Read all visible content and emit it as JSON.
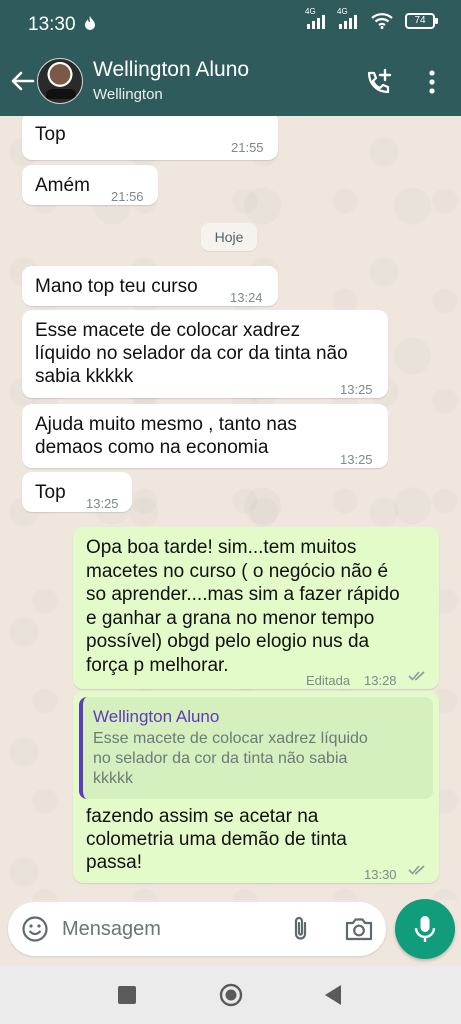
{
  "status_bar": {
    "time": "13:30",
    "network_1": "4G",
    "network_2": "4G",
    "battery": "74"
  },
  "header": {
    "contact_name": "Wellington Aluno",
    "contact_subtitle": "Wellington",
    "icons": [
      "back-arrow-icon",
      "add-call-icon",
      "more-vert-icon"
    ]
  },
  "chat": {
    "date_chip": "Hoje",
    "messages": [
      {
        "dir": "in",
        "text": "Top",
        "time": "21:55"
      },
      {
        "dir": "in",
        "text": "Amém",
        "time": "21:56"
      },
      {
        "dir": "in",
        "text": "Mano top teu curso",
        "time": "13:24"
      },
      {
        "dir": "in",
        "text": "Esse macete de colocar xadrez\nlíquido no selador da cor da tinta não\nsabia kkkkk",
        "time": "13:25"
      },
      {
        "dir": "in",
        "text": "Ajuda muito mesmo , tanto nas\ndemaos como na economia",
        "time": "13:25"
      },
      {
        "dir": "in",
        "text": "Top",
        "time": "13:25"
      },
      {
        "dir": "out",
        "text": "Opa boa tarde! sim...tem muitos\nmacetes no curso ( o negócio não é\nso aprender....mas sim a fazer rápido\ne ganhar a grana no menor tempo\npossível) obgd pelo elogio nus da\nforça p melhorar.",
        "edited_label": "Editada",
        "time": "13:28"
      },
      {
        "dir": "out",
        "quote_author": "Wellington Aluno",
        "quote_text": "Esse macete de colocar xadrez líquido\nno selador da cor da tinta não sabia\nkkkkk",
        "text": "fazendo assim se acetar na\ncolometria uma demão de tinta\npassa!",
        "time": "13:30"
      }
    ]
  },
  "composer": {
    "placeholder": "Mensagem",
    "icons": [
      "emoji-icon",
      "attach-icon",
      "camera-icon",
      "mic-icon"
    ]
  },
  "colors": {
    "header": "#2f5b5c",
    "incoming_bubble": "#ffffff",
    "outgoing_bubble": "#e2fbc9",
    "mic_button": "#119c7c",
    "quote_accent": "#5b3db8"
  }
}
